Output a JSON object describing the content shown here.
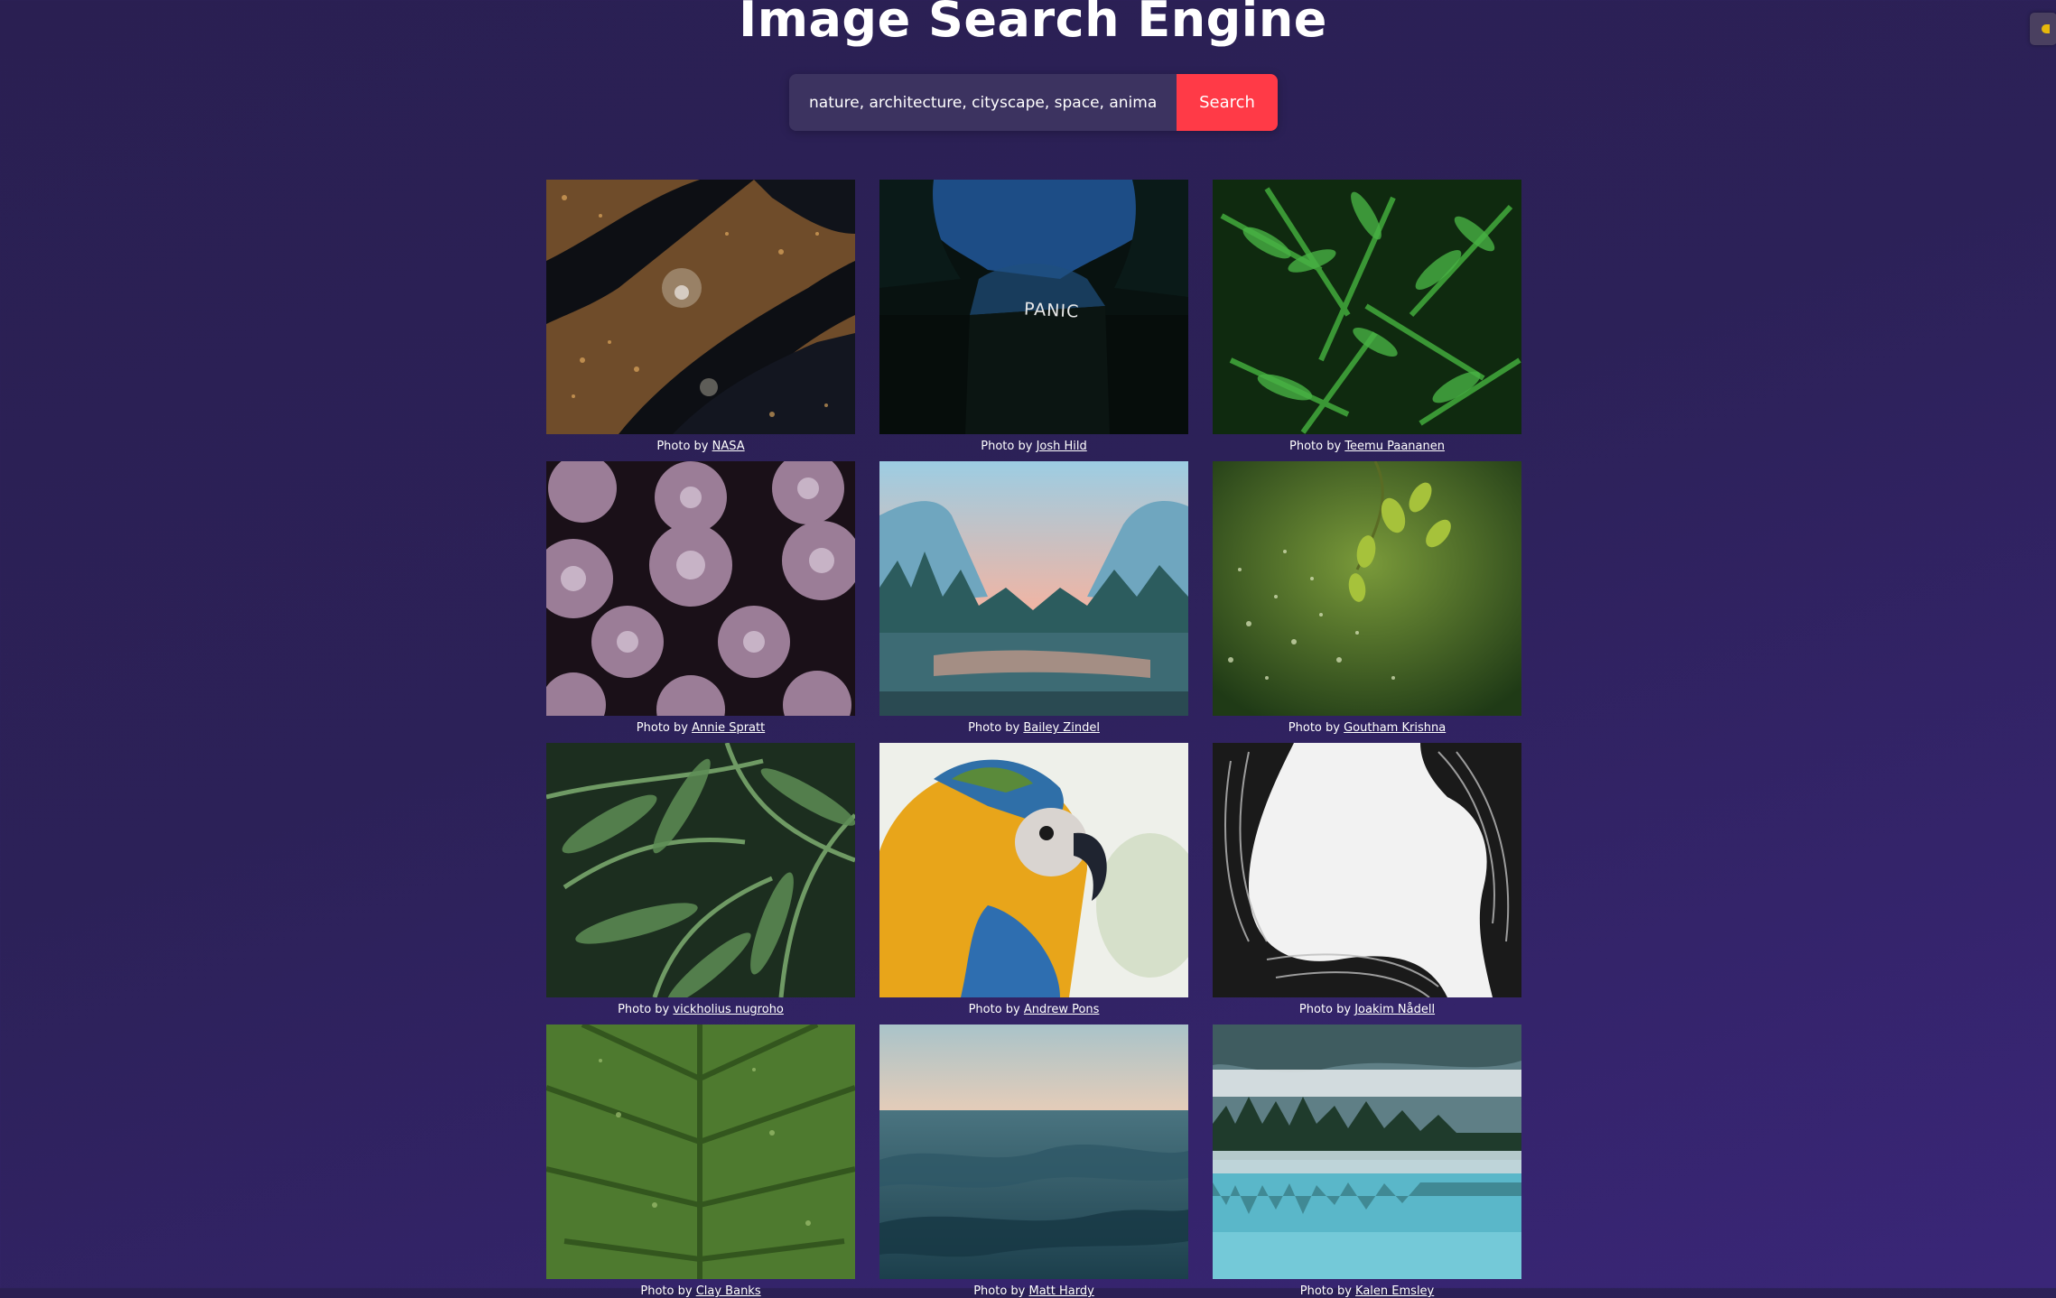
{
  "page": {
    "title": "Image Search Engine",
    "search_placeholder": "nature, architecture, cityscape, space, animals, wildlife",
    "search_button_label": "Search",
    "theme_toggle_icon": "half-moon-icon"
  },
  "results": [
    {
      "prefix": "Photo by",
      "author": "NASA",
      "subject": "city-lights-from-space"
    },
    {
      "prefix": "Photo by",
      "author": "Josh Hild",
      "subject": "dark-building-panic-sign",
      "sign_text": "PANIC"
    },
    {
      "prefix": "Photo by",
      "author": "Teemu Paananen",
      "subject": "green-ferns"
    },
    {
      "prefix": "Photo by",
      "author": "Annie Spratt",
      "subject": "purple-succulents"
    },
    {
      "prefix": "Photo by",
      "author": "Bailey Zindel",
      "subject": "mountain-valley-river"
    },
    {
      "prefix": "Photo by",
      "author": "Goutham Krishna",
      "subject": "bokeh-leaves"
    },
    {
      "prefix": "Photo by",
      "author": "vickholius nugroho",
      "subject": "palm-leaves"
    },
    {
      "prefix": "Photo by",
      "author": "Andrew Pons",
      "subject": "blue-yellow-macaw"
    },
    {
      "prefix": "Photo by",
      "author": "Joakim Nådell",
      "subject": "curved-building"
    },
    {
      "prefix": "Photo by",
      "author": "Clay Banks",
      "subject": "green-leaf-closeup"
    },
    {
      "prefix": "Photo by",
      "author": "Matt Hardy",
      "subject": "ocean-waves"
    },
    {
      "prefix": "Photo by",
      "author": "Kalen Emsley",
      "subject": "misty-lake-forest"
    }
  ],
  "colors": {
    "background": "#2c2158",
    "search_button": "#ff3a47",
    "search_input": "#3c3360"
  }
}
